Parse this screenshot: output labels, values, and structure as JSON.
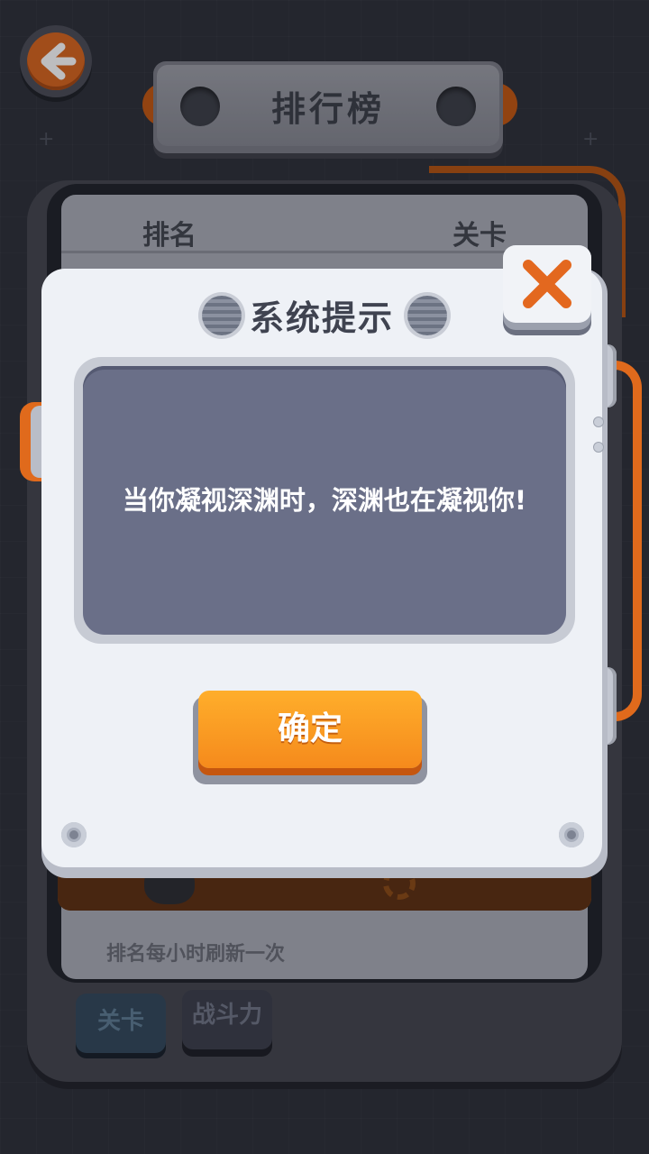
{
  "header": {
    "title": "排行榜",
    "back_icon": "arrow-left-icon"
  },
  "leaderboard": {
    "columns": [
      "排名",
      "关卡"
    ],
    "refresh_note": "排名每小时刷新一次"
  },
  "tabs": [
    {
      "label": "关卡"
    },
    {
      "label": "战斗力"
    }
  ],
  "dialog": {
    "title": "系统提示",
    "message": "当你凝视深渊时，深渊也在凝视你!",
    "confirm_label": "确定",
    "close_icon": "close-icon"
  },
  "colors": {
    "accent_orange": "#f58a1c",
    "message_box": "#6a6f88",
    "dialog_face": "#eef1f6"
  }
}
